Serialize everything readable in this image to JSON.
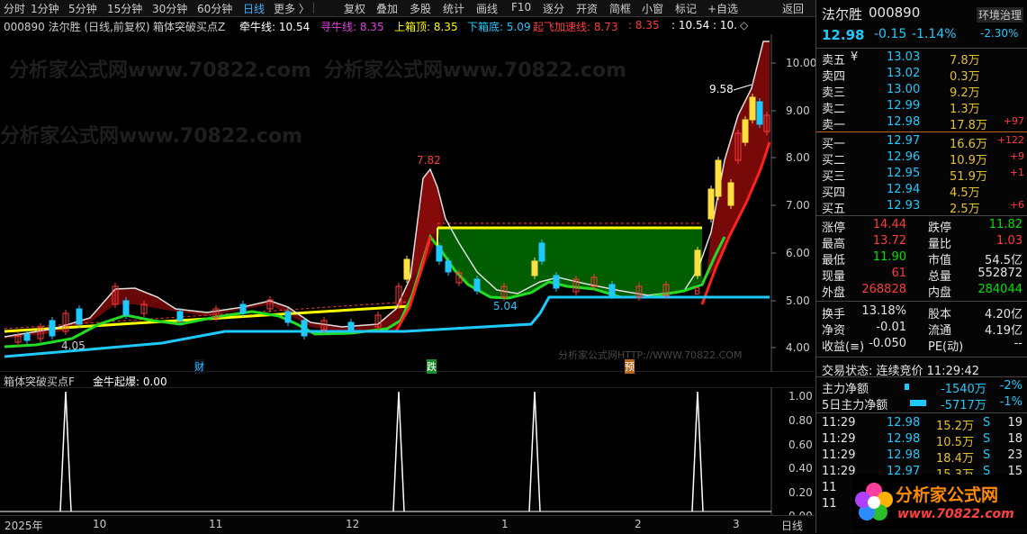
{
  "toolbar": {
    "items": [
      "分时",
      "1分钟",
      "5分钟",
      "15分钟",
      "30分钟",
      "60分钟",
      "日线",
      "更多 〉",
      "复权",
      "叠加",
      "多股",
      "统计",
      "画线",
      "F10",
      "逐分",
      "开资",
      "简框",
      "小窗",
      "标记",
      "+自选",
      "返回"
    ]
  },
  "header": {
    "code_name": "000890 法尔胜 (日线,前复权)",
    "indicator": "箱体突破买点Z",
    "qianniu": "牵牛线: 10.54",
    "xunniu": "寻牛线: 8.35",
    "shang_xiangding": "上箱顶: 8.35",
    "xia_xiangdi": "下箱底: 5.09",
    "qifei": "起飞加速线: 8.73",
    "v6": ": 8.35",
    "v7": ": 10.54",
    "v8": ": 10.",
    "diamond": "◇"
  },
  "main_axis": {
    "labels": [
      "10.00",
      "9.00",
      "8.00",
      "7.00",
      "6.00",
      "5.00",
      "4.00"
    ]
  },
  "annotations": {
    "peak1": "7.82",
    "peak2": "9.58",
    "low1": "5.04",
    "low0": "4.05",
    "tag_cai": "财",
    "tag_die": "跌",
    "tag_yu": "预",
    "tag_b": "B",
    "watermark_url": "分析家公式网HTTP://WWW.70822.COM"
  },
  "sub_header": {
    "indicator": "箱体突破买点F",
    "value": "金牛起爆: 0.00"
  },
  "sub_axis": {
    "labels": [
      "1.00",
      "0.80",
      "0.60",
      "0.40",
      "0.20",
      "0.00"
    ]
  },
  "x_axis": {
    "labels": [
      "2025年",
      "10",
      "11",
      "12",
      "1",
      "2",
      "3"
    ],
    "period": "日线"
  },
  "watermarks": [
    "分析家公式网www.70822.com",
    "分析家公式网www.70822.com",
    "分析家公式网www.70822.com"
  ],
  "panel": {
    "name": "法尔胜",
    "code": "000890",
    "price": "12.98",
    "change": "-0.15",
    "change_pct": "-1.14%",
    "sector": "环境治理",
    "sector_pct": "-2.30%",
    "asks": [
      {
        "label": "卖五",
        "mark": "¥",
        "price": "13.03",
        "vol": "7.8万",
        "delta": ""
      },
      {
        "label": "卖四",
        "mark": "",
        "price": "13.02",
        "vol": "0.3万",
        "delta": ""
      },
      {
        "label": "卖三",
        "mark": "",
        "price": "13.00",
        "vol": "9.2万",
        "delta": ""
      },
      {
        "label": "卖二",
        "mark": "",
        "price": "12.99",
        "vol": "1.3万",
        "delta": ""
      },
      {
        "label": "卖一",
        "mark": "",
        "price": "12.98",
        "vol": "17.8万",
        "delta": "+97"
      }
    ],
    "bids": [
      {
        "label": "买一",
        "price": "12.97",
        "vol": "16.6万",
        "delta": "+122"
      },
      {
        "label": "买二",
        "price": "12.96",
        "vol": "10.9万",
        "delta": "+9"
      },
      {
        "label": "买三",
        "price": "12.95",
        "vol": "51.9万",
        "delta": "+1"
      },
      {
        "label": "买四",
        "price": "12.94",
        "vol": "4.5万",
        "delta": ""
      },
      {
        "label": "买五",
        "price": "12.93",
        "vol": "2.5万",
        "delta": "+6"
      }
    ],
    "stats": [
      {
        "l1": "涨停",
        "v1": "14.44",
        "c1": "red",
        "l2": "跌停",
        "v2": "11.82",
        "c2": "green"
      },
      {
        "l1": "最高",
        "v1": "13.72",
        "c1": "red",
        "l2": "量比",
        "v2": "1.03",
        "c2": "red"
      },
      {
        "l1": "最低",
        "v1": "11.90",
        "c1": "green",
        "l2": "市值",
        "v2": "54.5亿",
        "c2": "white"
      },
      {
        "l1": "现量",
        "v1": "61",
        "c1": "red",
        "l2": "总量",
        "v2": "552872",
        "c2": "white"
      },
      {
        "l1": "外盘",
        "v1": "268828",
        "c1": "red",
        "l2": "内盘",
        "v2": "284044",
        "c2": "green"
      }
    ],
    "stats2": [
      {
        "l1": "换手",
        "v1": "13.18%",
        "l2": "股本",
        "v2": "4.20亿"
      },
      {
        "l1": "净资",
        "v1": "-0.01",
        "l2": "流通",
        "v2": "4.19亿"
      },
      {
        "l1": "收益(≡)",
        "v1": "-0.050",
        "l2": "PE(动)",
        "v2": "--"
      }
    ],
    "trade_status": "交易状态: 连续竞价 11:29:42",
    "capital": [
      {
        "label": "主力净额",
        "val": "-1540万",
        "pct": "-2%"
      },
      {
        "label": "5日主力净额",
        "val": "-5717万",
        "pct": "-1%"
      }
    ],
    "ticks": [
      {
        "t": "11:29",
        "p": "12.98",
        "v": "15.2万",
        "s": "S",
        "n": "19"
      },
      {
        "t": "11:29",
        "p": "12.98",
        "v": "10.5万",
        "s": "S",
        "n": "18"
      },
      {
        "t": "11:29",
        "p": "12.98",
        "v": "18.4万",
        "s": "S",
        "n": "23"
      },
      {
        "t": "11:29",
        "p": "12.97",
        "v": "15.3万",
        "s": "S",
        "n": "15"
      },
      {
        "t": "11",
        "p": "",
        "v": "",
        "s": "",
        "n": ""
      },
      {
        "t": "11",
        "p": "",
        "v": "",
        "s": "",
        "n": ""
      }
    ],
    "logo_text": "分析家公式网",
    "logo_url": "www.70822.com"
  }
}
